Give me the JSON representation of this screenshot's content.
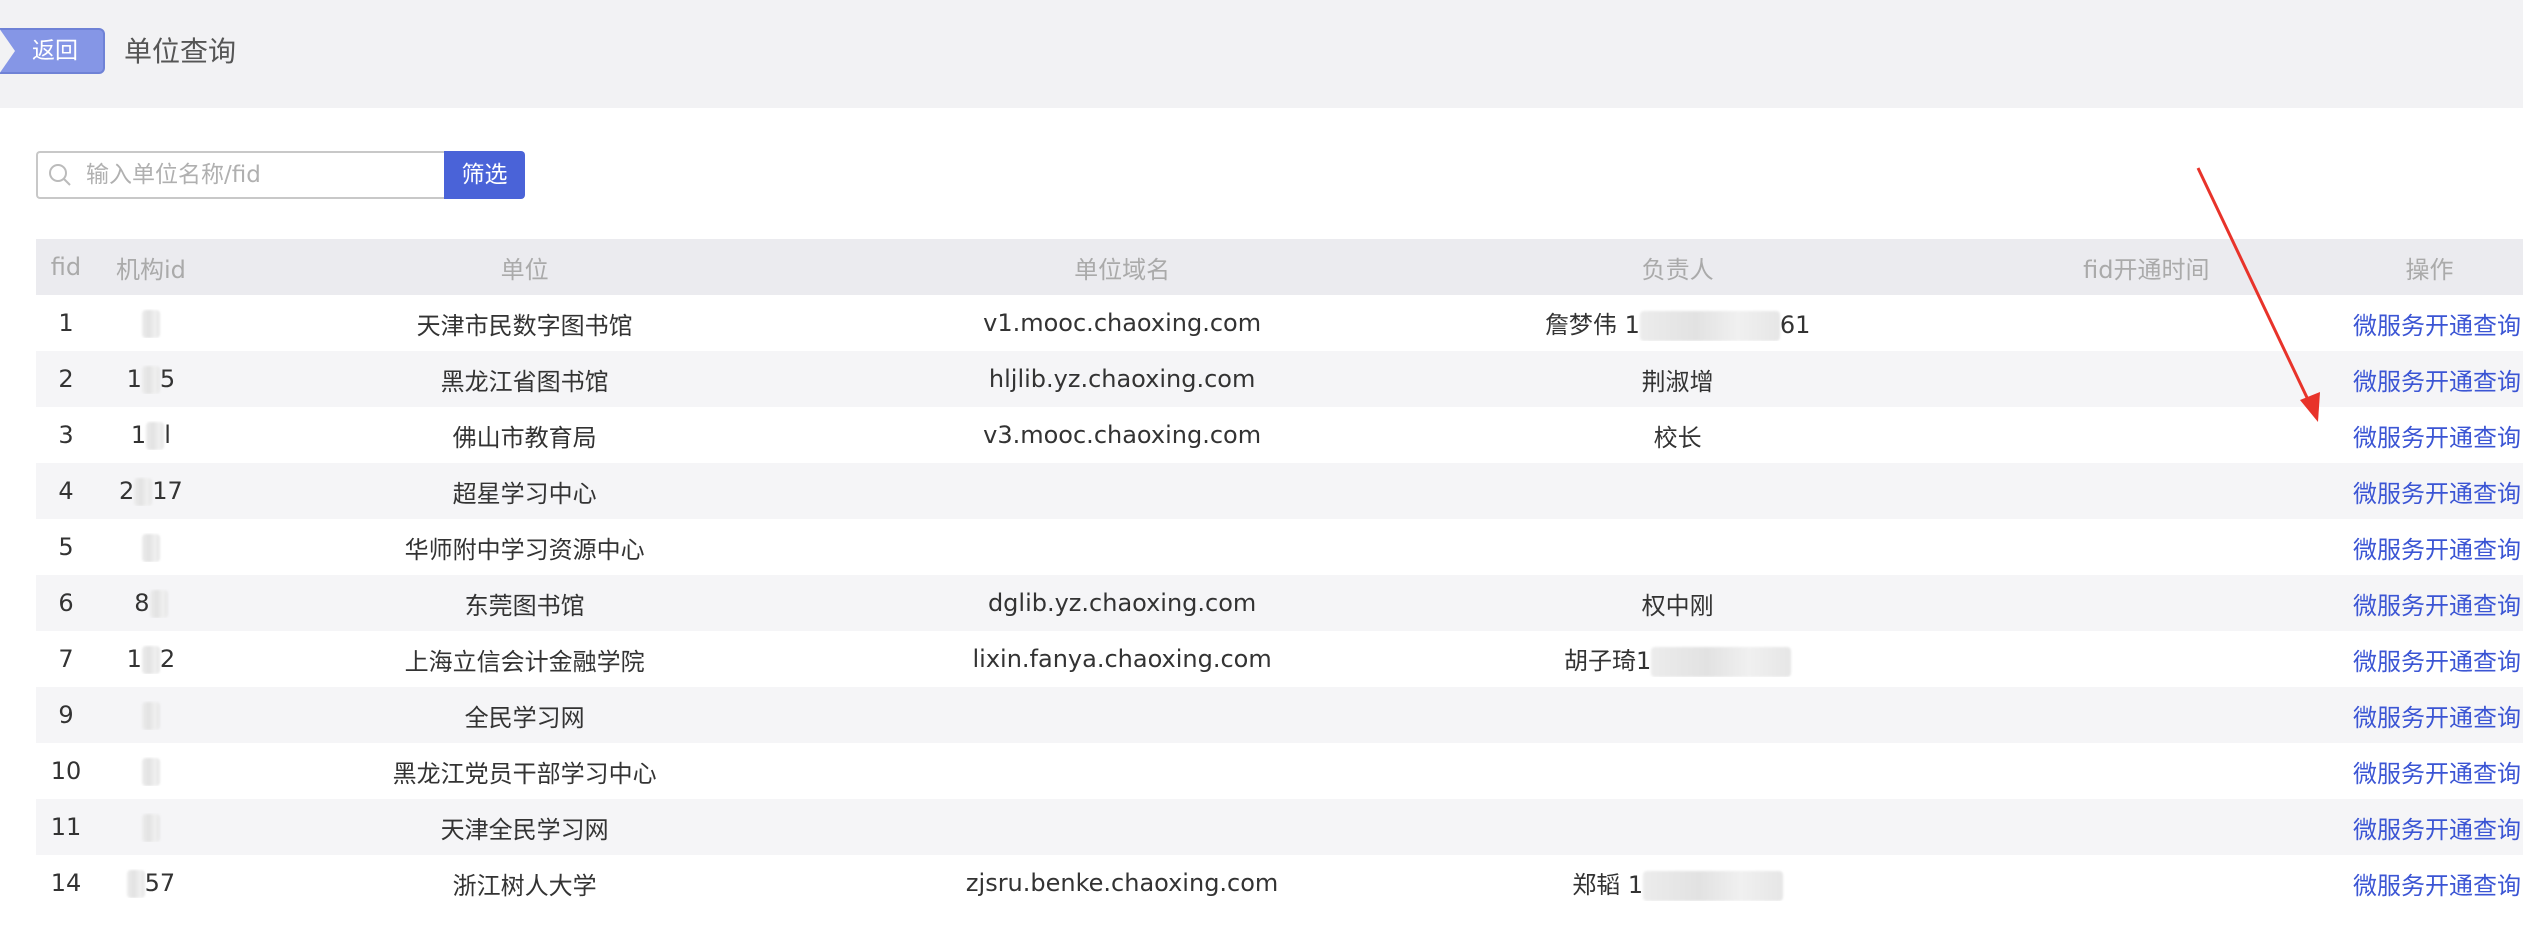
{
  "header": {
    "back_label": "返回",
    "title": "单位查询"
  },
  "search": {
    "placeholder": "输入单位名称/fid",
    "value": "",
    "filter_label": "筛选"
  },
  "table": {
    "columns": [
      "fid",
      "机构id",
      "单位",
      "单位域名",
      "负责人",
      "fid开通时间",
      "操作"
    ],
    "rows": [
      {
        "fid": "1",
        "org": "",
        "unit": "天津市民数字图书馆",
        "domain": "v1.mooc.chaoxing.com",
        "owner": "詹梦伟 1",
        "owner_tail": "61",
        "time": "",
        "op": "微服务开通查询"
      },
      {
        "fid": "2",
        "org": "1",
        "org_tail": "5",
        "unit": "黑龙江省图书馆",
        "domain": "hljlib.yz.chaoxing.com",
        "owner": "荆淑增",
        "owner_tail": "",
        "time": "",
        "op": "微服务开通查询"
      },
      {
        "fid": "3",
        "org": "1",
        "org_tail": "l",
        "unit": "佛山市教育局",
        "domain": "v3.mooc.chaoxing.com",
        "owner": "校长",
        "owner_tail": "",
        "time": "",
        "op": "微服务开通查询"
      },
      {
        "fid": "4",
        "org": "2",
        "org_tail": "17",
        "unit": "超星学习中心",
        "domain": "",
        "owner": "",
        "owner_tail": "",
        "time": "",
        "op": "微服务开通查询"
      },
      {
        "fid": "5",
        "org": "",
        "org_tail": "",
        "unit": "华师附中学习资源中心",
        "domain": "",
        "owner": "",
        "owner_tail": "",
        "time": "",
        "op": "微服务开通查询"
      },
      {
        "fid": "6",
        "org": "8",
        "org_tail": "",
        "unit": "东莞图书馆",
        "domain": "dglib.yz.chaoxing.com",
        "owner": "权中刚",
        "owner_tail": "",
        "time": "",
        "op": "微服务开通查询"
      },
      {
        "fid": "7",
        "org": "1",
        "org_tail": "2",
        "unit": "上海立信会计金融学院",
        "domain": "lixin.fanya.chaoxing.com",
        "owner": "胡子琦1",
        "owner_tail": "",
        "time": "",
        "op": "微服务开通查询"
      },
      {
        "fid": "9",
        "org": "",
        "org_tail": "",
        "unit": "全民学习网",
        "domain": "",
        "owner": "",
        "owner_tail": "",
        "time": "",
        "op": "微服务开通查询"
      },
      {
        "fid": "10",
        "org": "",
        "org_tail": "",
        "unit": "黑龙江党员干部学习中心",
        "domain": "",
        "owner": "",
        "owner_tail": "",
        "time": "",
        "op": "微服务开通查询"
      },
      {
        "fid": "11",
        "org": "",
        "org_tail": "",
        "unit": "天津全民学习网",
        "domain": "",
        "owner": "",
        "owner_tail": "",
        "time": "",
        "op": "微服务开通查询"
      },
      {
        "fid": "14",
        "org": "",
        "org_tail": "57",
        "unit": "浙江树人大学",
        "domain": "zjsru.benke.chaoxing.com",
        "owner": "郑韬 1",
        "owner_tail": "",
        "time": "",
        "op": "微服务开通查询"
      }
    ]
  },
  "colors": {
    "accent": "#4a63d8",
    "back_button": "#8596e6",
    "link": "#3b55d4",
    "annotation_arrow": "#e8332a"
  }
}
